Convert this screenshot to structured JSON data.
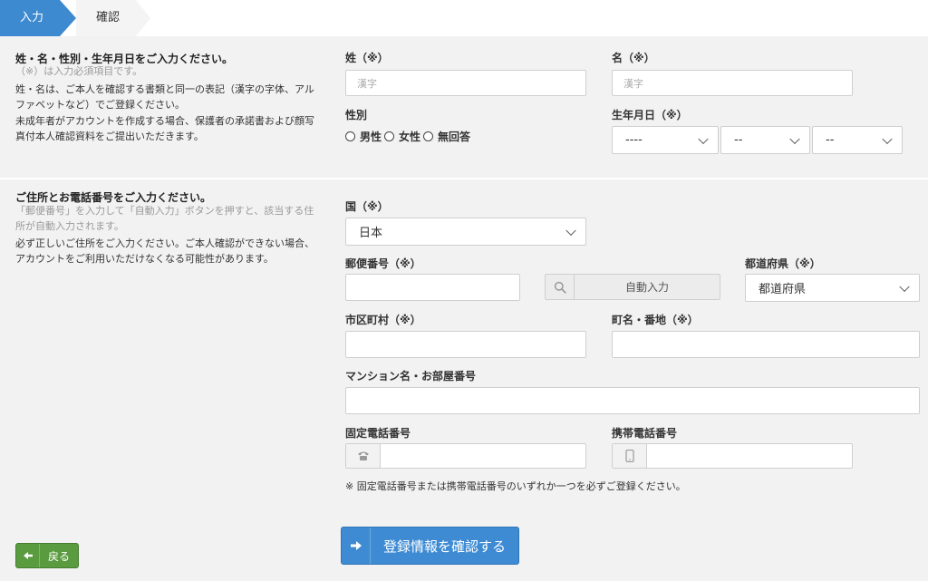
{
  "stepper": {
    "step1": "入力",
    "step2": "確認"
  },
  "section1": {
    "title": "姓・名・性別・生年月日をご入力ください。",
    "required_note": "（※）は入力必須項目です。",
    "text1_line1": "姓・名は、ご本人を確認する書類と同一の表記（漢字の字体、アル",
    "text1_line2": "ファベットなど）でご登録ください。",
    "text2_line1": "未成年者がアカウントを作成する場合、保護者の承諾書および顔写",
    "text2_line2": "真付本人確認資料をご提出いただきます。"
  },
  "section2": {
    "title": "ご住所とお電話番号をご入力ください。",
    "note_line1": "「郵便番号」を入力して「自動入力」ボタンを押すと、該当する住",
    "note_line2": "所が自動入力されます。",
    "text_line1": "必ず正しいご住所をご入力ください。ご本人確認ができない場合、",
    "text_line2": "アカウントをご利用いただけなくなる可能性があります。"
  },
  "fields": {
    "last_name": {
      "label": "姓（※）",
      "placeholder": "漢字",
      "value": ""
    },
    "first_name": {
      "label": "名（※）",
      "placeholder": "漢字",
      "value": ""
    },
    "gender": {
      "label": "性別",
      "options": [
        "男性",
        "女性",
        "無回答"
      ]
    },
    "birthdate": {
      "label": "生年月日（※）",
      "year": "----",
      "month": "--",
      "day": "--"
    },
    "country": {
      "label": "国（※）",
      "value": "日本"
    },
    "postal_code": {
      "label": "郵便番号（※）",
      "value": ""
    },
    "auto_fill": {
      "label": "自動入力"
    },
    "prefecture": {
      "label": "都道府県（※）",
      "value": "都道府県"
    },
    "city": {
      "label": "市区町村（※）",
      "value": ""
    },
    "street": {
      "label": "町名・番地（※）",
      "value": ""
    },
    "building": {
      "label": "マンション名・お部屋番号",
      "value": ""
    },
    "landline": {
      "label": "固定電話番号",
      "value": ""
    },
    "mobile": {
      "label": "携帯電話番号",
      "value": ""
    },
    "phone_note": "※ 固定電話番号または携帯電話番号のいずれか一つを必ずご登録ください。"
  },
  "buttons": {
    "submit": "登録情報を確認する",
    "back": "戻る"
  },
  "icons": {
    "search": "search-icon",
    "phone": "phone-icon",
    "mobile": "mobile-icon",
    "arrow_right": "arrow-right-icon",
    "arrow_left": "arrow-left-icon"
  },
  "colors": {
    "accent": "#3d8ad0",
    "back": "#5a9b3f"
  }
}
